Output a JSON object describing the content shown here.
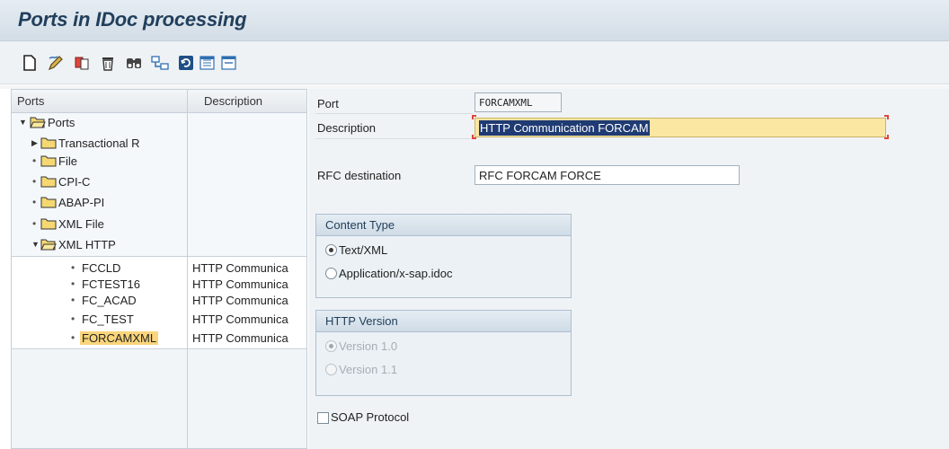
{
  "title": "Ports in IDoc processing",
  "toolbar": {
    "buttons": [
      {
        "name": "create-icon"
      },
      {
        "name": "change-icon"
      },
      {
        "name": "copy-icon"
      },
      {
        "name": "delete-icon"
      },
      {
        "name": "find-icon"
      },
      {
        "name": "where-used-icon"
      },
      {
        "name": "refresh-icon"
      },
      {
        "name": "expand-icon"
      },
      {
        "name": "collapse-icon"
      }
    ]
  },
  "tree": {
    "header_ports": "Ports",
    "header_description": "Description",
    "root": "Ports",
    "nodes": [
      "Transactional R",
      "File",
      "CPI-C",
      "ABAP-PI",
      "XML File",
      "XML HTTP"
    ],
    "leaves": [
      {
        "name": "FCCLD",
        "description": "HTTP Communica"
      },
      {
        "name": "FCTEST16",
        "description": "HTTP Communica"
      },
      {
        "name": "FC_ACAD",
        "description": "HTTP Communica"
      },
      {
        "name": "FC_TEST",
        "description": "HTTP Communica"
      },
      {
        "name": "FORCAMXML",
        "description": "HTTP Communica"
      }
    ]
  },
  "form": {
    "port_label": "Port",
    "port_value": "FORCAMXML",
    "description_label": "Description",
    "description_value": "HTTP Communication FORCAM",
    "rfc_label": "RFC destination",
    "rfc_value": "RFC FORCAM FORCE",
    "content_type": {
      "title": "Content Type",
      "options": [
        "Text/XML",
        "Application/x-sap.idoc"
      ],
      "selected": "Text/XML"
    },
    "http_version": {
      "title": "HTTP Version",
      "options": [
        "Version 1.0",
        "Version 1.1"
      ],
      "selected": "Version 1.0",
      "disabled": true
    },
    "soap_label": "SOAP Protocol",
    "soap_checked": false
  },
  "colors": {
    "title_text": "#213f5c",
    "selection_highlight": "#f9d57b",
    "focused_field": "#fbe6a2",
    "selected_text_bg": "#1f3b73"
  }
}
